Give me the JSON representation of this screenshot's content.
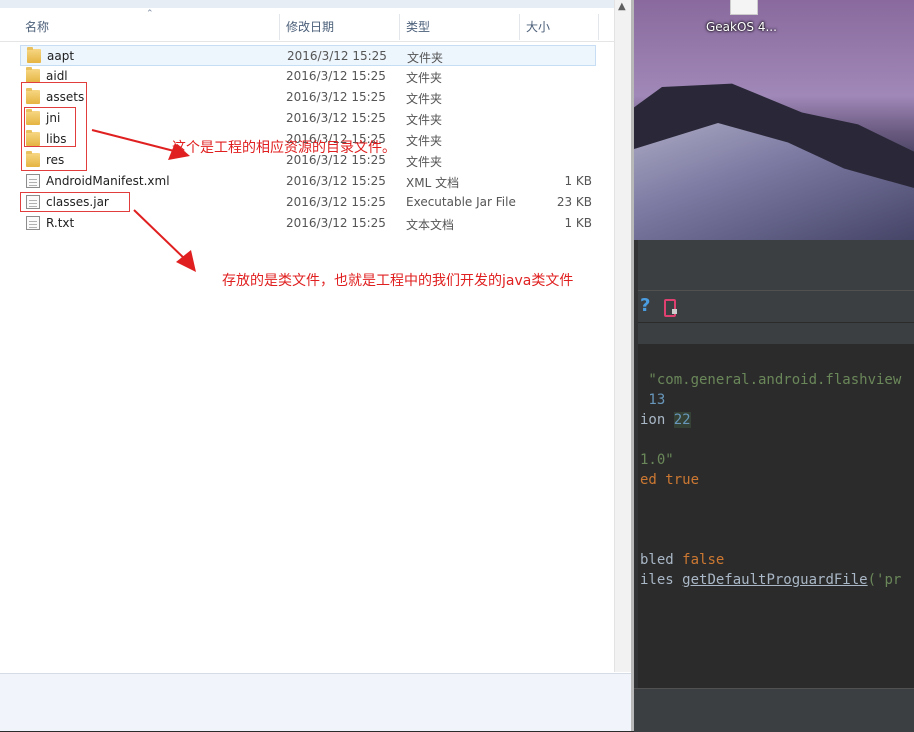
{
  "explorer": {
    "columns": {
      "name": "名称",
      "modified": "修改日期",
      "type": "类型",
      "size": "大小"
    },
    "files": [
      {
        "name": "aapt",
        "date": "2016/3/12 15:25",
        "type": "文件夹",
        "size": "",
        "kind": "folder",
        "selected": true
      },
      {
        "name": "aidl",
        "date": "2016/3/12 15:25",
        "type": "文件夹",
        "size": "",
        "kind": "folder"
      },
      {
        "name": "assets",
        "date": "2016/3/12 15:25",
        "type": "文件夹",
        "size": "",
        "kind": "folder"
      },
      {
        "name": "jni",
        "date": "2016/3/12 15:25",
        "type": "文件夹",
        "size": "",
        "kind": "folder"
      },
      {
        "name": "libs",
        "date": "2016/3/12 15:25",
        "type": "文件夹",
        "size": "",
        "kind": "folder"
      },
      {
        "name": "res",
        "date": "2016/3/12 15:25",
        "type": "文件夹",
        "size": "",
        "kind": "folder"
      },
      {
        "name": "AndroidManifest.xml",
        "date": "2016/3/12 15:25",
        "type": "XML 文档",
        "size": "1 KB",
        "kind": "file"
      },
      {
        "name": "classes.jar",
        "date": "2016/3/12 15:25",
        "type": "Executable Jar File",
        "size": "23 KB",
        "kind": "file"
      },
      {
        "name": "R.txt",
        "date": "2016/3/12 15:25",
        "type": "文本文档",
        "size": "1 KB",
        "kind": "file"
      }
    ]
  },
  "annotations": {
    "folders_note": "这个是工程的相应资源的目录文件。",
    "jar_note": "存放的是类文件，也就是工程中的我们开发的java类文件",
    "color": "#e02020"
  },
  "desktop": {
    "icon_label": "GeakOS 4..."
  },
  "ide": {
    "toolbar_icons": [
      "help-icon",
      "android-device-icon"
    ],
    "code_lines": [
      {
        "parts": [
          {
            "t": " \"com.general.android.flashview",
            "c": "str"
          }
        ]
      },
      {
        "parts": [
          {
            "t": " 13",
            "c": "num"
          }
        ]
      },
      {
        "parts": [
          {
            "t": "ion ",
            "c": "plain"
          },
          {
            "t": "22",
            "c": "numhl"
          }
        ]
      },
      {
        "parts": []
      },
      {
        "parts": [
          {
            "t": "1.0\"",
            "c": "str"
          }
        ]
      },
      {
        "parts": [
          {
            "t": "ed ",
            "c": "kw"
          },
          {
            "t": "true",
            "c": "kw"
          }
        ]
      },
      {
        "parts": []
      },
      {
        "parts": []
      },
      {
        "parts": [
          {
            "t": "bled ",
            "c": "plain"
          },
          {
            "t": "false",
            "c": "kw"
          }
        ]
      },
      {
        "parts": [
          {
            "t": "iles ",
            "c": "plain"
          },
          {
            "t": "getDefaultProguardFile",
            "c": "fn"
          },
          {
            "t": "('pr",
            "c": "str"
          }
        ]
      }
    ]
  }
}
